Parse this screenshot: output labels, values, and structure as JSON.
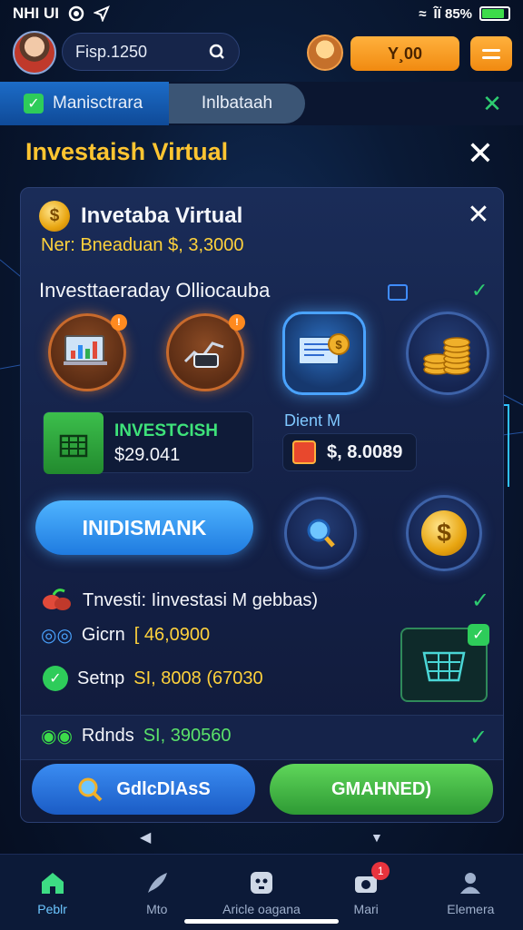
{
  "status_bar": {
    "left_text": "NHI UI",
    "right_text": "ÎÏ 85%",
    "battery_level": 0.85
  },
  "topbar": {
    "search_text": "Fisp.1250",
    "coin_label": "Y¸00"
  },
  "tabs": {
    "active_label": "Manisctrara",
    "second_label": "Inlbataah"
  },
  "heading": {
    "title": "Investaish Virtual"
  },
  "panel": {
    "title": "Invetaba Virtual",
    "balance": "Ner: Bneaduan $, 3,3000",
    "subtitle": "Investtaeraday Olliocauba",
    "invest_card": {
      "label": "INVESTCISH",
      "value": "$29.041"
    },
    "dient_label": "Dient M",
    "value_box_text": "$, 8.0089",
    "big_button_label": "INIDISMANK",
    "invest_row": "Tnvesti: Iinvestasi M gebbas)",
    "giten_label": "Gicrn",
    "giten_value": "[ 46,0900",
    "setup_label": "Setnp",
    "setup_value": "SI, 8008 (67030",
    "rounds_label": "Rdnds",
    "rounds_value": "SI, 390560",
    "btn_left_label": "GdlcDlAsS",
    "btn_right_label": "GMAHNED)"
  },
  "bottom_nav": {
    "items": [
      {
        "label": "Peblr",
        "icon": "home-icon"
      },
      {
        "label": "Mto",
        "icon": "feather-icon"
      },
      {
        "label": "Aricle oagana",
        "icon": "game-icon"
      },
      {
        "label": "Mari",
        "icon": "camera-icon",
        "badge": "1"
      },
      {
        "label": "Elemera",
        "icon": "user-icon"
      }
    ]
  },
  "colors": {
    "accent_gold": "#ffc531",
    "accent_green": "#2ecc71",
    "accent_blue": "#1f7be0",
    "accent_orange": "#f18a10"
  }
}
